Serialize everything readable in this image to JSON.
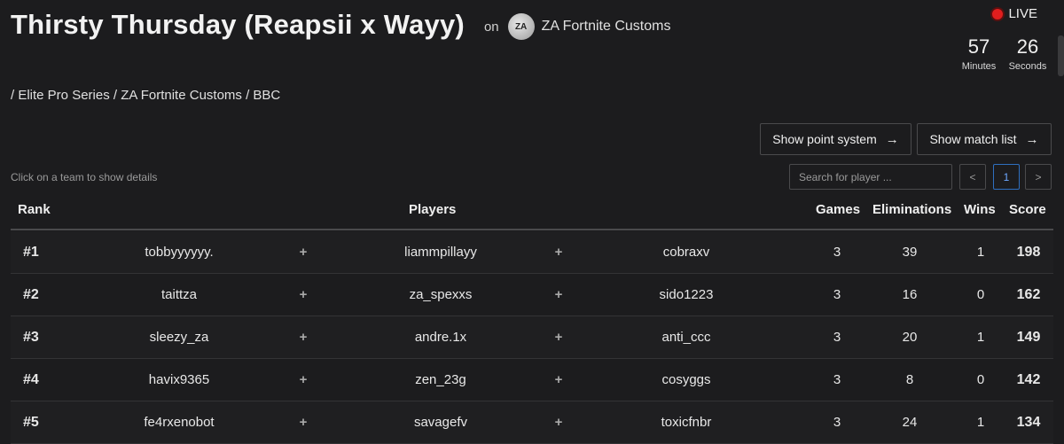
{
  "header": {
    "title": "Thirsty Thursday (Reapsii x Wayy)",
    "on_label": "on",
    "org_logo_text": "ZA",
    "org_name": "ZA Fortnite Customs"
  },
  "status": {
    "live_label": "LIVE",
    "minutes": "57",
    "minutes_label": "Minutes",
    "seconds": "26",
    "seconds_label": "Seconds",
    "live_color": "#e01e1e"
  },
  "breadcrumb": "/ Elite Pro Series / ZA Fortnite Customs / BBC",
  "buttons": {
    "point_system": "Show point system",
    "match_list": "Show match list",
    "arrow_icon": "arrow-right-icon"
  },
  "hint": "Click on a team to show details",
  "search": {
    "placeholder": "Search for player ...",
    "value": ""
  },
  "pagination": {
    "prev": "<",
    "current": "1",
    "next": ">"
  },
  "table": {
    "columns": {
      "rank": "Rank",
      "players": "Players",
      "games": "Games",
      "eliminations": "Eliminations",
      "wins": "Wins",
      "score": "Score"
    },
    "rows": [
      {
        "rank": "#1",
        "p1": "tobbyyyyyy.",
        "p2": "liammpillayy",
        "p3": "cobraxv",
        "games": "3",
        "elims": "39",
        "wins": "1",
        "score": "198"
      },
      {
        "rank": "#2",
        "p1": "taittza",
        "p2": "za_spexxs",
        "p3": "sido1223",
        "games": "3",
        "elims": "16",
        "wins": "0",
        "score": "162"
      },
      {
        "rank": "#3",
        "p1": "sleezy_za",
        "p2": "andre.1x",
        "p3": "anti_ccc",
        "games": "3",
        "elims": "20",
        "wins": "1",
        "score": "149"
      },
      {
        "rank": "#4",
        "p1": "havix9365",
        "p2": "zen_23g",
        "p3": "cosyggs",
        "games": "3",
        "elims": "8",
        "wins": "0",
        "score": "142"
      },
      {
        "rank": "#5",
        "p1": "fe4rxenobot",
        "p2": "savagefv",
        "p3": "toxicfnbr",
        "games": "3",
        "elims": "24",
        "wins": "1",
        "score": "134"
      }
    ],
    "plus": "+"
  }
}
